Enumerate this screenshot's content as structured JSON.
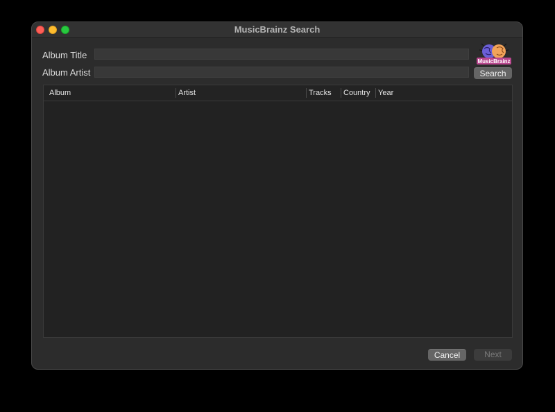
{
  "window": {
    "title": "MusicBrainz Search"
  },
  "form": {
    "album_title_label": "Album Title",
    "album_title_value": "",
    "album_artist_label": "Album Artist",
    "album_artist_value": "",
    "search_label": "Search"
  },
  "logo": {
    "text": "MusicBrainz",
    "colors": [
      "#ba478f",
      "#eb743b",
      "#5a4fc9"
    ]
  },
  "table": {
    "columns": [
      "Album",
      "Artist",
      "Tracks",
      "Country",
      "Year"
    ],
    "rows": []
  },
  "footer": {
    "cancel_label": "Cancel",
    "next_label": "Next"
  },
  "colors": {
    "window_bg": "#2c2c2c",
    "close": "#fe5f57",
    "minimize": "#febc2e",
    "maximize": "#28c840"
  }
}
